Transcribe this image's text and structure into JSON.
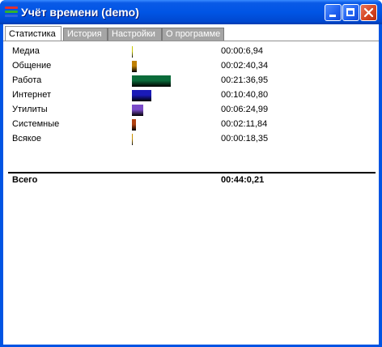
{
  "window": {
    "title": "Учёт времени (demo)"
  },
  "titlebar": {
    "minimize": "minimize-icon",
    "maximize": "maximize-icon",
    "close": "close-icon"
  },
  "tabs": [
    {
      "label": "Статистика",
      "active": true
    },
    {
      "label": "История",
      "active": false
    },
    {
      "label": "Настройки",
      "active": false
    },
    {
      "label": "О программе",
      "active": false
    }
  ],
  "stats": {
    "rows": [
      {
        "name": "Медиа",
        "time": "00:00:6,94",
        "share": 0.0026,
        "color": "#c8c800"
      },
      {
        "name": "Общение",
        "time": "00:02:40,34",
        "share": 0.061,
        "color": "#c08000"
      },
      {
        "name": "Работа",
        "time": "00:21:36,95",
        "share": 0.491,
        "color": "#0b6b3a"
      },
      {
        "name": "Интернет",
        "time": "00:10:40,80",
        "share": 0.243,
        "color": "#1a1ab8"
      },
      {
        "name": "Утилиты",
        "time": "00:06:24,99",
        "share": 0.146,
        "color": "#7a4bc8"
      },
      {
        "name": "Системные",
        "time": "00:02:11,84",
        "share": 0.05,
        "color": "#b04010"
      },
      {
        "name": "Всякое",
        "time": "00:00:18,35",
        "share": 0.007,
        "color": "#c89000"
      }
    ],
    "total": {
      "name": "Всего",
      "time": "00:44:0,21"
    }
  }
}
